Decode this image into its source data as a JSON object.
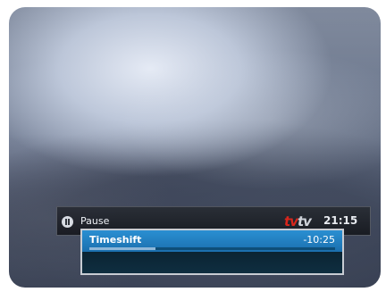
{
  "osd": {
    "status": {
      "state_label": "Pause",
      "brand_part1": "tv",
      "brand_part2": "tv",
      "clock": "21:15"
    },
    "timeshift": {
      "title": "Timeshift",
      "remaining": "-10:25",
      "progress_fraction": 0.27
    }
  },
  "colors": {
    "header_blue": "#1f7cbf",
    "panel_dark": "#0d2a3a",
    "brand_red": "#d9261c",
    "progress_fill": "#8fb7d8"
  },
  "icons": {
    "state": "pause-icon"
  }
}
